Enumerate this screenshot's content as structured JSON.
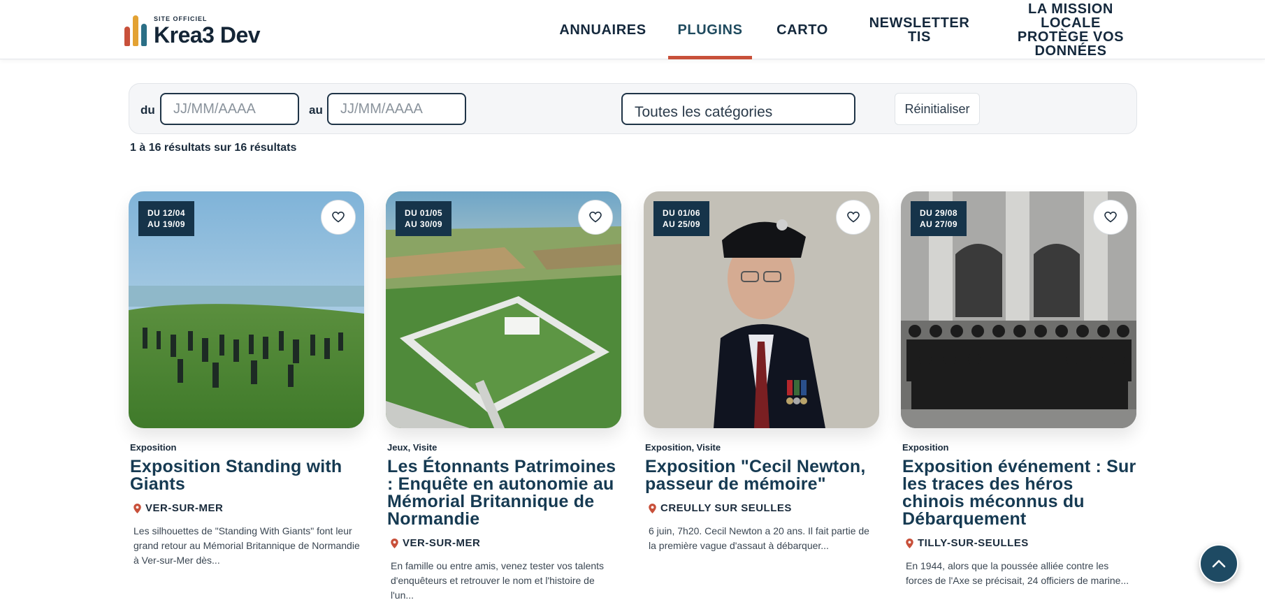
{
  "brand": {
    "small": "SITE OFFICIEL",
    "name": "Krea3 Dev",
    "colors": [
      "#c8503a",
      "#e3a233",
      "#2b6f86"
    ]
  },
  "nav": [
    {
      "label": "ANNUAIRES",
      "active": false
    },
    {
      "label": "PLUGINS",
      "active": true
    },
    {
      "label": "CARTO",
      "active": false
    },
    {
      "label": "NEWSLETTER TIS",
      "active": false
    },
    {
      "label": "LA MISSION LOCALE PROTÈGE VOS DONNÉES",
      "active": false
    }
  ],
  "filters": {
    "from_label": "du",
    "to_label": "au",
    "from_placeholder": "JJ/MM/AAAA",
    "to_placeholder": "JJ/MM/AAAA",
    "category": "Toutes les catégories",
    "reset": "Réinitialiser"
  },
  "results_text": "1 à 16 résultats sur 16 résultats",
  "cards": [
    {
      "date_from": "DU 12/04",
      "date_to": "AU 19/09",
      "category": "Exposition",
      "title": "Exposition Standing with Giants",
      "location": "VER-SUR-MER",
      "description": "Les silhouettes de \"Standing With Giants\" font leur grand retour au Mémorial Britannique de Normandie à Ver-sur-Mer dès..."
    },
    {
      "date_from": "DU 01/05",
      "date_to": "AU 30/09",
      "category": "Jeux, Visite",
      "title": "Les Étonnants Patrimoines : Enquête en autonomie au Mémorial Britannique de Normandie",
      "location": "VER-SUR-MER",
      "description": "En famille ou entre amis, venez tester vos talents d'enquêteurs et retrouver le nom et l'histoire de l'un..."
    },
    {
      "date_from": "DU 01/06",
      "date_to": "AU 25/09",
      "category": "Exposition, Visite",
      "title": "Exposition \"Cecil Newton, passeur de mémoire\"",
      "location": "CREULLY SUR SEULLES",
      "description": "6 juin, 7h20. Cecil Newton a 20 ans. Il fait partie de la première vague d'assaut à débarquer..."
    },
    {
      "date_from": "DU 29/08",
      "date_to": "AU 27/09",
      "category": "Exposition",
      "title": "Exposition événement : Sur les traces des héros chinois méconnus du Débarquement",
      "location": "TILLY-SUR-SEULLES",
      "description": "En 1944, alors que la poussée alliée contre les forces de l'Axe se précisait, 24 officiers de marine..."
    }
  ]
}
